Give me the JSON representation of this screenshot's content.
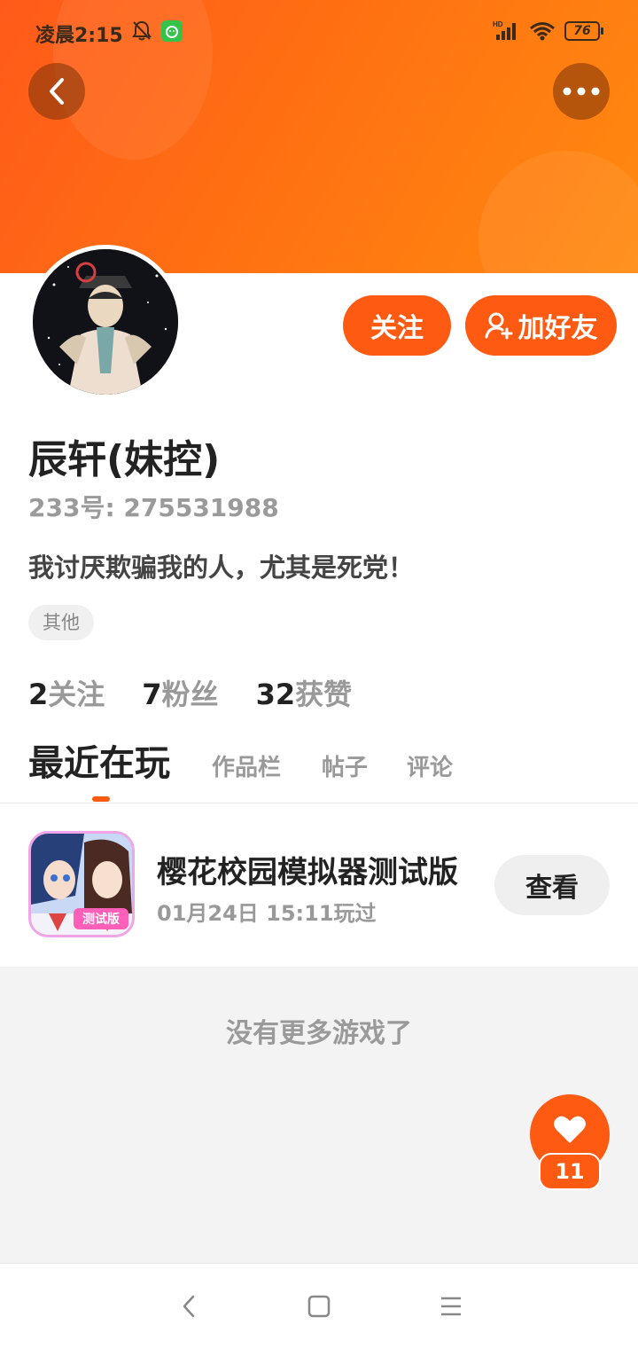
{
  "status_bar": {
    "time": "凌晨2:15",
    "battery": "76",
    "network": "HD"
  },
  "header": {
    "back_icon": "chevron-left-icon",
    "more_icon": "more-horizontal-icon"
  },
  "profile": {
    "username": "辰轩(妹控)",
    "id_text": "233号: 275531988",
    "bio": "我讨厌欺骗我的人，尤其是死党！",
    "tag": "其他",
    "follow_label": "关注",
    "add_friend_label": "加好友",
    "stats": [
      {
        "num": "2",
        "label": "关注"
      },
      {
        "num": "7",
        "label": "粉丝"
      },
      {
        "num": "32",
        "label": "获赞"
      }
    ]
  },
  "tabs": [
    "最近在玩",
    "作品栏",
    "帖子",
    "评论"
  ],
  "games": [
    {
      "name": "樱花校园模拟器测试版",
      "time": "01月24日 15:11玩过",
      "action": "查看",
      "icon_badge": "测试版"
    }
  ],
  "empty_text": "没有更多游戏了",
  "likes": {
    "count": "11"
  },
  "colors": {
    "accent": "#ff5a12",
    "banner_start": "#ff5a1a",
    "banner_end": "#ff8a10"
  }
}
